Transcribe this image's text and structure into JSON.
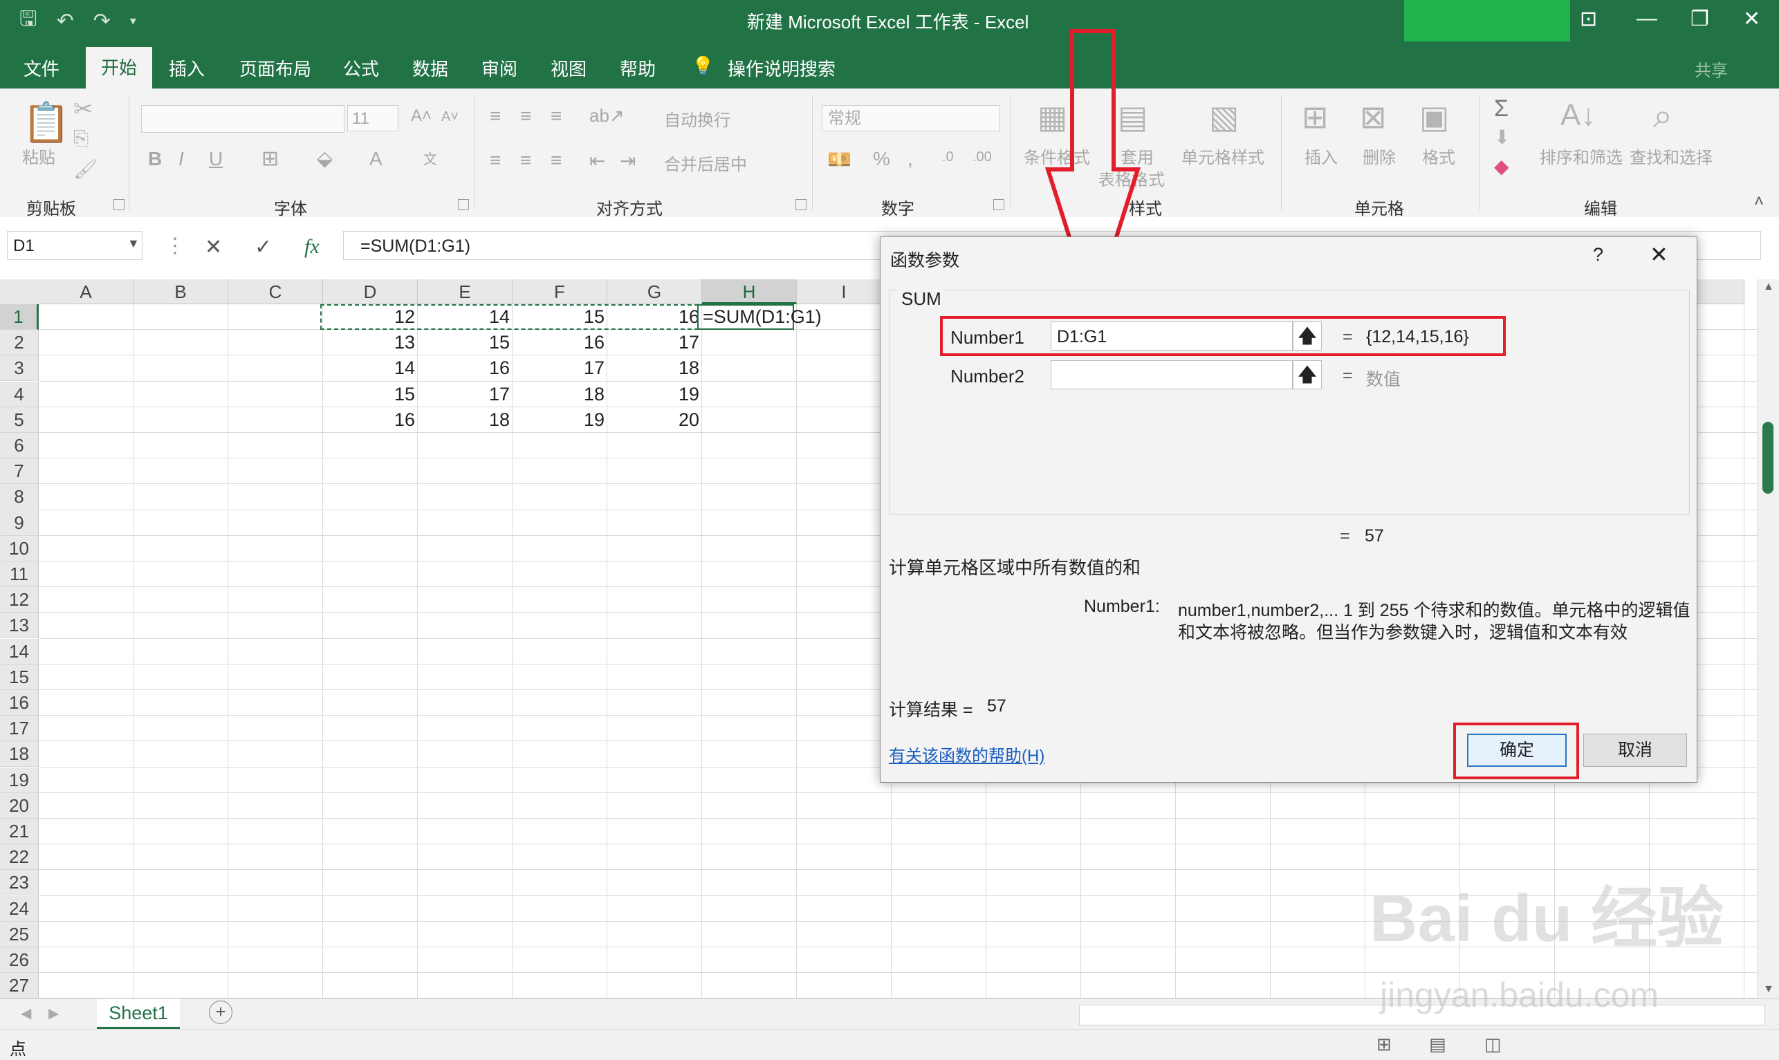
{
  "window": {
    "title": "新建 Microsoft Excel 工作表  -  Excel",
    "share": "共享"
  },
  "tabs": [
    "文件",
    "开始",
    "插入",
    "页面布局",
    "公式",
    "数据",
    "审阅",
    "视图",
    "帮助"
  ],
  "search_label": "操作说明搜索",
  "ribbon": {
    "clipboard": {
      "paste": "粘贴",
      "group": "剪贴板"
    },
    "font": {
      "size": "11",
      "group": "字体"
    },
    "alignment": {
      "wrap": "自动换行",
      "merge": "合并后居中",
      "group": "对齐方式"
    },
    "number": {
      "format": "常规",
      "group": "数字"
    },
    "styles": {
      "conditional": "条件格式",
      "table_a": "套用",
      "table_b": "表格格式",
      "cell": "单元格样式",
      "group": "样式"
    },
    "cells": {
      "insert": "插入",
      "delete": "删除",
      "format": "格式",
      "group": "单元格"
    },
    "editing": {
      "sort": "排序和筛选",
      "find": "查找和选择",
      "group": "编辑"
    }
  },
  "formula_bar": {
    "name_box": "D1",
    "formula": "=SUM(D1:G1)",
    "fx": "fx"
  },
  "grid": {
    "columns": [
      "A",
      "B",
      "C",
      "D",
      "E",
      "F",
      "G",
      "H",
      "I"
    ],
    "rows": [
      "1",
      "2",
      "3",
      "4",
      "5",
      "6",
      "7",
      "8",
      "9",
      "10",
      "11",
      "12",
      "13",
      "14",
      "15",
      "16",
      "17",
      "18",
      "19",
      "20",
      "21",
      "22",
      "23",
      "24",
      "25",
      "26",
      "27"
    ],
    "selected_column": "H",
    "selected_row": "1",
    "data": [
      [
        "12",
        "14",
        "15",
        "16"
      ],
      [
        "13",
        "15",
        "16",
        "17"
      ],
      [
        "14",
        "16",
        "17",
        "18"
      ],
      [
        "15",
        "17",
        "18",
        "19"
      ],
      [
        "16",
        "18",
        "19",
        "20"
      ]
    ],
    "h1_formula": "=SUM(D1:G1)"
  },
  "sheet": {
    "name": "Sheet1",
    "add": "+"
  },
  "status": {
    "mode": "点"
  },
  "dialog": {
    "title": "函数参数",
    "help": "?",
    "close": "✕",
    "function": "SUM",
    "args": [
      {
        "label": "Number1",
        "value": "D1:G1",
        "result": "{12,14,15,16}"
      },
      {
        "label": "Number2",
        "value": "",
        "result": "数值"
      }
    ],
    "eq": "=",
    "formula_result": "57",
    "description": "计算单元格区域中所有数值的和",
    "arg_help_label": "Number1:",
    "arg_help_line1": "number1,number2,...  1 到 255 个待求和的数值。单元格中的逻辑值",
    "arg_help_line2": "和文本将被忽略。但当作为参数键入时，逻辑值和文本有效",
    "calc_label": "计算结果 =",
    "calc_value": "57",
    "help_link": "有关该函数的帮助(H)",
    "ok": "确定",
    "cancel": "取消"
  },
  "watermark": {
    "line1": "Bai du 经验",
    "line2": "jingyan.baidu.com"
  },
  "colors": {
    "excel_green": "#217346",
    "highlight_red": "#e21e2b"
  }
}
